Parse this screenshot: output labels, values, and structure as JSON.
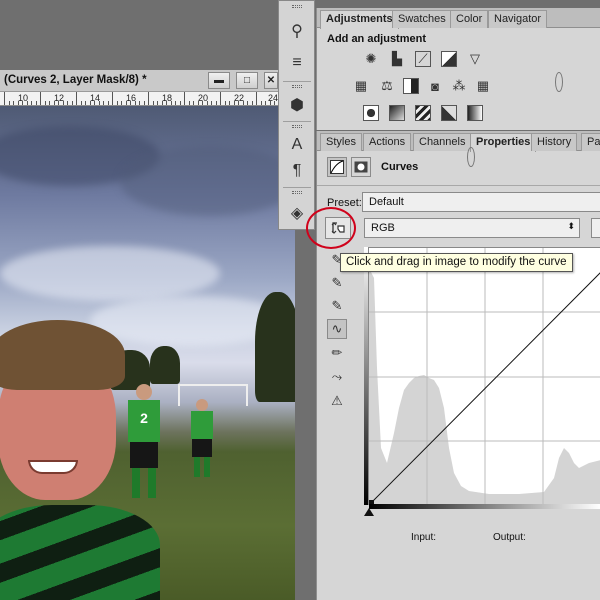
{
  "document": {
    "title": "(Curves 2, Layer Mask/8) *",
    "minimize_label": "▬",
    "restore_label": "□",
    "close_label": "✕",
    "ruler_labels": [
      "10",
      "12",
      "14",
      "16",
      "18",
      "20",
      "22",
      "24"
    ]
  },
  "adjustments_panel": {
    "tabs": [
      {
        "label": "Adjustments",
        "active": true
      },
      {
        "label": "Swatches",
        "active": false
      },
      {
        "label": "Color",
        "active": false
      },
      {
        "label": "Navigator",
        "active": false
      }
    ],
    "heading": "Add an adjustment",
    "icons_row1": [
      "brightness-contrast-icon",
      "levels-icon",
      "curves-icon",
      "exposure-icon",
      "vibrance-icon"
    ],
    "icons_row2": [
      "hue-saturation-icon",
      "color-balance-icon",
      "black-white-icon",
      "photo-filter-icon",
      "channel-mixer-icon",
      "color-lookup-icon"
    ],
    "icons_row3": [
      "invert-icon",
      "posterize-icon",
      "threshold-icon",
      "selective-color-icon",
      "gradient-map-icon"
    ]
  },
  "properties_panel": {
    "tabs": [
      {
        "label": "Styles",
        "active": false
      },
      {
        "label": "Actions",
        "active": false
      },
      {
        "label": "Channels",
        "active": false
      },
      {
        "label": "Properties",
        "active": true
      },
      {
        "label": "History",
        "active": false
      },
      {
        "label": "Pat",
        "active": false
      }
    ],
    "title": "Curves",
    "preset_label": "Preset:",
    "preset_value": "Default",
    "channel_value": "RGB",
    "input_label": "Input:",
    "output_label": "Output:"
  },
  "tooltip": "Click and drag in image to modify the curve",
  "colors": {
    "highlight_circle": "#d0021b",
    "tooltip_bg": "#ffffe1",
    "panel_bg": "#d6d6d6"
  }
}
